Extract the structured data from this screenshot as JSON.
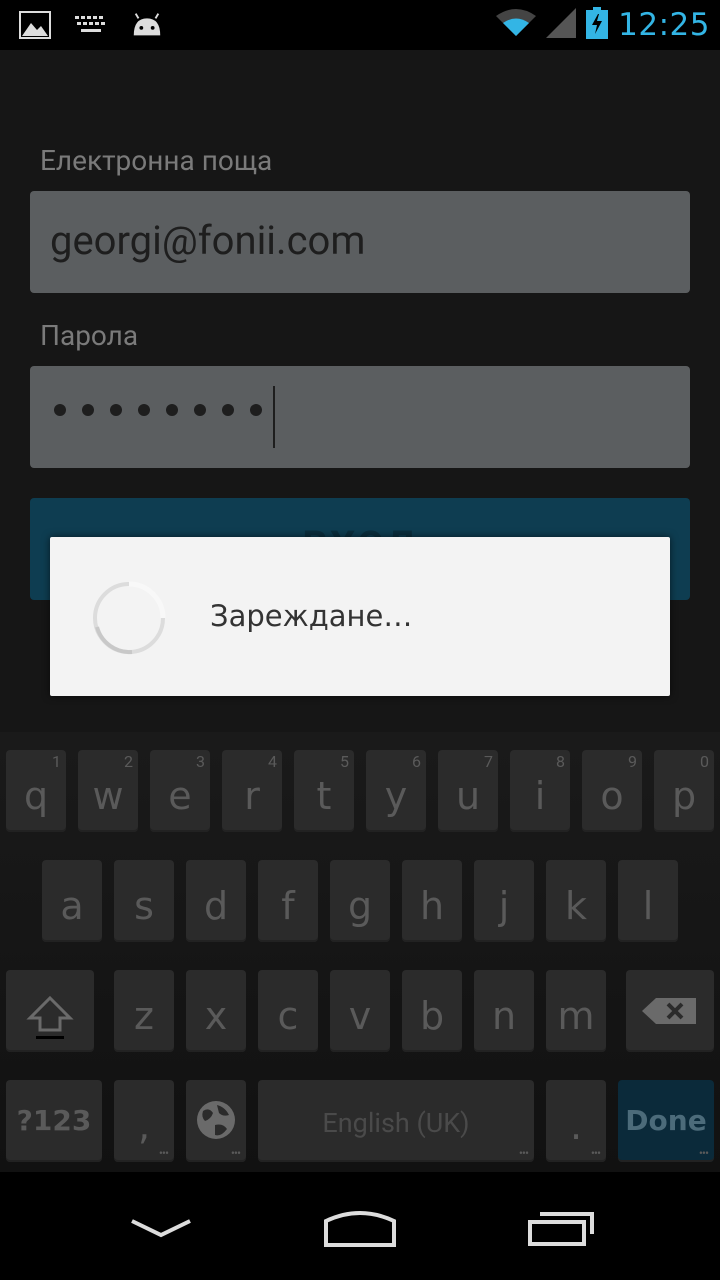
{
  "status_bar": {
    "time": "12:25",
    "icons": [
      "image-icon",
      "keyboard-icon",
      "android-icon",
      "wifi-icon",
      "signal-icon",
      "battery-charging-icon"
    ]
  },
  "form": {
    "email_label": "Електронна поща",
    "email_value": "georgi@fonii.com",
    "password_label": "Парола",
    "password_mask_count": 8,
    "login_button_label": "ВХОД"
  },
  "dialog": {
    "message": "Зареждане…"
  },
  "keyboard": {
    "row1": [
      {
        "letter": "q",
        "num": "1"
      },
      {
        "letter": "w",
        "num": "2"
      },
      {
        "letter": "e",
        "num": "3"
      },
      {
        "letter": "r",
        "num": "4"
      },
      {
        "letter": "t",
        "num": "5"
      },
      {
        "letter": "y",
        "num": "6"
      },
      {
        "letter": "u",
        "num": "7"
      },
      {
        "letter": "i",
        "num": "8"
      },
      {
        "letter": "o",
        "num": "9"
      },
      {
        "letter": "p",
        "num": "0"
      }
    ],
    "row2": [
      "a",
      "s",
      "d",
      "f",
      "g",
      "h",
      "j",
      "k",
      "l"
    ],
    "row3": [
      "z",
      "x",
      "c",
      "v",
      "b",
      "n",
      "m"
    ],
    "symbols_key": "?123",
    "comma_key": ",",
    "space_label": "English (UK)",
    "period_key": ".",
    "done_key": "Done"
  },
  "nav_bar": {
    "icons": [
      "back-icon",
      "home-icon",
      "recent-apps-icon"
    ]
  }
}
